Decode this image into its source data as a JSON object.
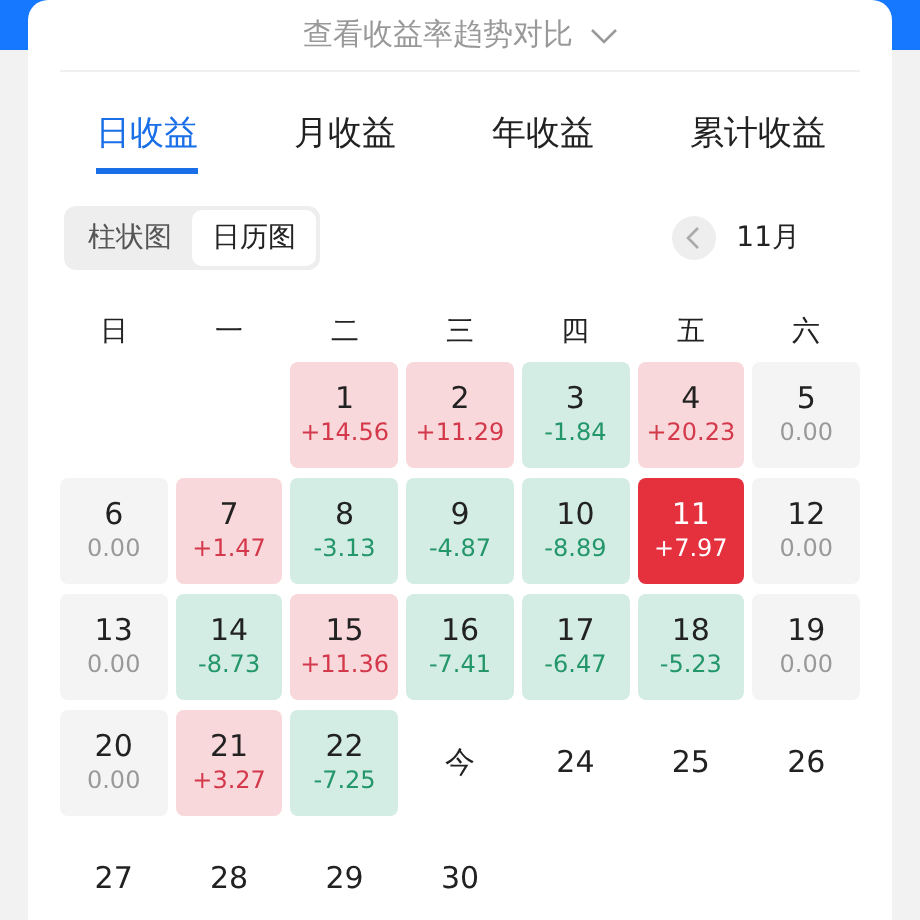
{
  "header": {
    "trend_link": "查看收益率趋势对比"
  },
  "tabs": [
    {
      "label": "日收益",
      "selected": true
    },
    {
      "label": "月收益",
      "selected": false
    },
    {
      "label": "年收益",
      "selected": false
    },
    {
      "label": "累计收益",
      "selected": false
    }
  ],
  "view_toggle": [
    {
      "label": "柱状图",
      "selected": false
    },
    {
      "label": "日历图",
      "selected": true
    }
  ],
  "month": {
    "label": "11月"
  },
  "calendar": {
    "weekdays": [
      "日",
      "一",
      "二",
      "三",
      "四",
      "五",
      "六"
    ],
    "weeks": [
      [
        {
          "kind": "blank"
        },
        {
          "kind": "blank"
        },
        {
          "kind": "up",
          "day": "1",
          "change": "+14.56",
          "selected": false
        },
        {
          "kind": "up",
          "day": "2",
          "change": "+11.29",
          "selected": false
        },
        {
          "kind": "down",
          "day": "3",
          "change": "-1.84",
          "selected": false
        },
        {
          "kind": "up",
          "day": "4",
          "change": "+20.23",
          "selected": false
        },
        {
          "kind": "flat",
          "day": "5",
          "change": "0.00",
          "selected": false
        }
      ],
      [
        {
          "kind": "flat",
          "day": "6",
          "change": "0.00",
          "selected": false
        },
        {
          "kind": "up",
          "day": "7",
          "change": "+1.47",
          "selected": false
        },
        {
          "kind": "down",
          "day": "8",
          "change": "-3.13",
          "selected": false
        },
        {
          "kind": "down",
          "day": "9",
          "change": "-4.87",
          "selected": false
        },
        {
          "kind": "down",
          "day": "10",
          "change": "-8.89",
          "selected": false
        },
        {
          "kind": "up",
          "day": "11",
          "change": "+7.97",
          "selected": true
        },
        {
          "kind": "flat",
          "day": "12",
          "change": "0.00",
          "selected": false
        }
      ],
      [
        {
          "kind": "flat",
          "day": "13",
          "change": "0.00",
          "selected": false
        },
        {
          "kind": "down",
          "day": "14",
          "change": "-8.73",
          "selected": false
        },
        {
          "kind": "up",
          "day": "15",
          "change": "+11.36",
          "selected": false
        },
        {
          "kind": "down",
          "day": "16",
          "change": "-7.41",
          "selected": false
        },
        {
          "kind": "down",
          "day": "17",
          "change": "-6.47",
          "selected": false
        },
        {
          "kind": "down",
          "day": "18",
          "change": "-5.23",
          "selected": false
        },
        {
          "kind": "flat",
          "day": "19",
          "change": "0.00",
          "selected": false
        }
      ],
      [
        {
          "kind": "flat",
          "day": "20",
          "change": "0.00",
          "selected": false
        },
        {
          "kind": "up",
          "day": "21",
          "change": "+3.27",
          "selected": false
        },
        {
          "kind": "down",
          "day": "22",
          "change": "-7.25",
          "selected": false
        },
        {
          "kind": "future",
          "day": "今",
          "selected": false
        },
        {
          "kind": "future",
          "day": "24",
          "selected": false
        },
        {
          "kind": "future",
          "day": "25",
          "selected": false
        },
        {
          "kind": "future",
          "day": "26",
          "selected": false
        }
      ],
      [
        {
          "kind": "future",
          "day": "27",
          "selected": false
        },
        {
          "kind": "future",
          "day": "28",
          "selected": false
        },
        {
          "kind": "future",
          "day": "29",
          "selected": false
        },
        {
          "kind": "future",
          "day": "30",
          "selected": false
        }
      ]
    ]
  }
}
